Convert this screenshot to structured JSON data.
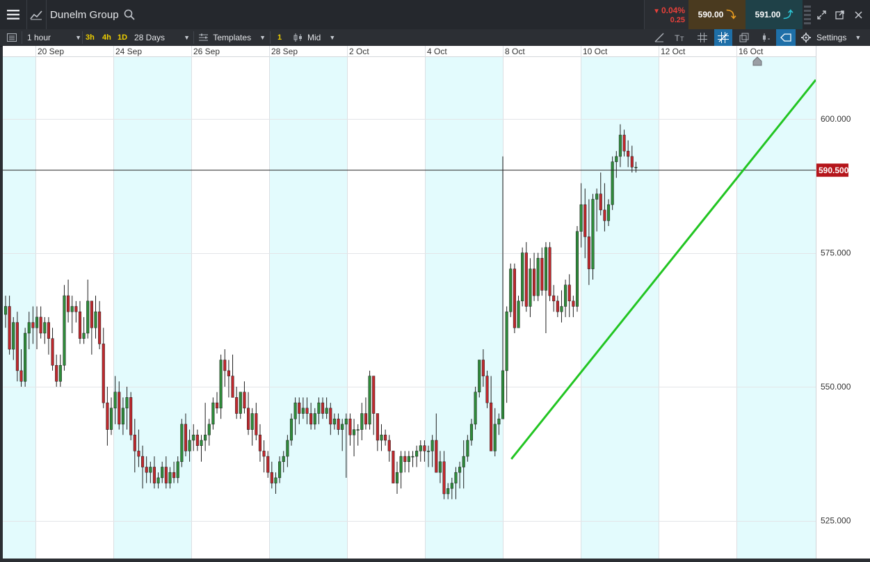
{
  "header": {
    "title": "Dunelm Group",
    "change_pct": "0.04%",
    "change_abs": "0.25",
    "sell_price": "590.00",
    "buy_price": "591.00",
    "icons": [
      "menu-icon",
      "chart-type-icon",
      "search-icon",
      "expand-icon",
      "popout-icon",
      "close-icon"
    ]
  },
  "toolbar": {
    "interval": "1 hour",
    "quick_intervals": [
      "3h",
      "4h",
      "1D"
    ],
    "range": "28 Days",
    "templates_label": "Templates",
    "badge": "1",
    "price_type": "Mid",
    "settings_label": "Settings"
  },
  "chart_data": {
    "type": "candlestick",
    "x_ticks": [
      "20 Sep",
      "24 Sep",
      "26 Sep",
      "28 Sep",
      "2 Oct",
      "4 Oct",
      "8 Oct",
      "10 Oct",
      "12 Oct",
      "16 Oct"
    ],
    "y_ticks": [
      "600.000",
      "575.000",
      "550.000",
      "525.000"
    ],
    "ylim": [
      520.0,
      608.0
    ],
    "current_price": "590.500",
    "colors": {
      "up": "#2e8b3a",
      "down": "#c0282d",
      "trend": "#22c522",
      "price_tag": "#b5151b",
      "weekend": "#e3fbfd"
    },
    "candles": [
      [
        563.5,
        567,
        561,
        565
      ],
      [
        565,
        567,
        556,
        557
      ],
      [
        557,
        563,
        555,
        562
      ],
      [
        562,
        564,
        551,
        553
      ],
      [
        553,
        557,
        550,
        551
      ],
      [
        551,
        561,
        550,
        560
      ],
      [
        560,
        564,
        557,
        562
      ],
      [
        562,
        565,
        558,
        561
      ],
      [
        561,
        565,
        557,
        563
      ],
      [
        563,
        565,
        559,
        560
      ],
      [
        560,
        563,
        558,
        562
      ],
      [
        562,
        563,
        556,
        559
      ],
      [
        559,
        561,
        553,
        554
      ],
      [
        554,
        556,
        550,
        551
      ],
      [
        551,
        556,
        550,
        554
      ],
      [
        554,
        569,
        553,
        567
      ],
      [
        567,
        570,
        562,
        564
      ],
      [
        564,
        567,
        560,
        565
      ],
      [
        565,
        566,
        562,
        564
      ],
      [
        564,
        566,
        558,
        559
      ],
      [
        559,
        563,
        558,
        560
      ],
      [
        560,
        570,
        559,
        566
      ],
      [
        566,
        566,
        556,
        561
      ],
      [
        561,
        567,
        559,
        564
      ],
      [
        564,
        566,
        557,
        558
      ],
      [
        558,
        561,
        546,
        547
      ],
      [
        547,
        550,
        539,
        542
      ],
      [
        542,
        548,
        541,
        546
      ],
      [
        546,
        552,
        543,
        549
      ],
      [
        549,
        551,
        542,
        543
      ],
      [
        543,
        548,
        541,
        546
      ],
      [
        546,
        550,
        542,
        548
      ],
      [
        548,
        549,
        540,
        541
      ],
      [
        541,
        544,
        534,
        538
      ],
      [
        538,
        542,
        535,
        537
      ],
      [
        537,
        539,
        531,
        535
      ],
      [
        535,
        537,
        532,
        534
      ],
      [
        534,
        536,
        532,
        535
      ],
      [
        535,
        537,
        531,
        532
      ],
      [
        532,
        534,
        531,
        533
      ],
      [
        533,
        536,
        532,
        535
      ],
      [
        535,
        537,
        531,
        532
      ],
      [
        532,
        535,
        531,
        534
      ],
      [
        534,
        536,
        532,
        533
      ],
      [
        533,
        537,
        532,
        536
      ],
      [
        536,
        544,
        535,
        543
      ],
      [
        543,
        545,
        537,
        538
      ],
      [
        538,
        542,
        536,
        540
      ],
      [
        540,
        543,
        538,
        541
      ],
      [
        541,
        542,
        538,
        539
      ],
      [
        539,
        541,
        536,
        540
      ],
      [
        540,
        547,
        538,
        541
      ],
      [
        541,
        544,
        539,
        543
      ],
      [
        543,
        548,
        542,
        547
      ],
      [
        547,
        549,
        545,
        546
      ],
      [
        546,
        556,
        544,
        555
      ],
      [
        555,
        557,
        550,
        553
      ],
      [
        553,
        555,
        548,
        552
      ],
      [
        552,
        556,
        548,
        548
      ],
      [
        548,
        550,
        544,
        545
      ],
      [
        545,
        549,
        544,
        549
      ],
      [
        549,
        551,
        545,
        546
      ],
      [
        546,
        549,
        541,
        542
      ],
      [
        542,
        546,
        539,
        545
      ],
      [
        545,
        547,
        540,
        541
      ],
      [
        541,
        543,
        536,
        538
      ],
      [
        538,
        540,
        534,
        537
      ],
      [
        537,
        538,
        533,
        534
      ],
      [
        534,
        536,
        531,
        532
      ],
      [
        532,
        534,
        530,
        533
      ],
      [
        533,
        537,
        532,
        536
      ],
      [
        536,
        538,
        534,
        537
      ],
      [
        537,
        541,
        535,
        540
      ],
      [
        540,
        545,
        539,
        544
      ],
      [
        544,
        548,
        541,
        547
      ],
      [
        547,
        548,
        543,
        545
      ],
      [
        545,
        548,
        544,
        546
      ],
      [
        546,
        548,
        543,
        545
      ],
      [
        545,
        547,
        542,
        543
      ],
      [
        543,
        546,
        542,
        545
      ],
      [
        545,
        548,
        543,
        547
      ],
      [
        547,
        548,
        544,
        545
      ],
      [
        545,
        548,
        544,
        546
      ],
      [
        546,
        547,
        541,
        543
      ],
      [
        543,
        545,
        542,
        544
      ],
      [
        544,
        545,
        541,
        542
      ],
      [
        542,
        544,
        538,
        543
      ],
      [
        543,
        545,
        533,
        544
      ],
      [
        544,
        545,
        539,
        541
      ],
      [
        541,
        544,
        537,
        542
      ],
      [
        542,
        543,
        539,
        542
      ],
      [
        542,
        547,
        540,
        545
      ],
      [
        545,
        548,
        542,
        543
      ],
      [
        543,
        553,
        542,
        552
      ],
      [
        552,
        552,
        541,
        545
      ],
      [
        545,
        545,
        538,
        540
      ],
      [
        540,
        543,
        538,
        541
      ],
      [
        541,
        542,
        539,
        540
      ],
      [
        540,
        541,
        536,
        538
      ],
      [
        538,
        538,
        532,
        532
      ],
      [
        532,
        536,
        530,
        534
      ],
      [
        534,
        538,
        531,
        537
      ],
      [
        537,
        538,
        534,
        536
      ],
      [
        536,
        538,
        534,
        537
      ],
      [
        537,
        538,
        535,
        537
      ],
      [
        537,
        539,
        535,
        538
      ],
      [
        538,
        540,
        536,
        539
      ],
      [
        539,
        540,
        536,
        538
      ],
      [
        538,
        539,
        535,
        538
      ],
      [
        538,
        541,
        535,
        540
      ],
      [
        540,
        545,
        534,
        534
      ],
      [
        534,
        538,
        532,
        536
      ],
      [
        536,
        538,
        529,
        530
      ],
      [
        530,
        532,
        529,
        531
      ],
      [
        531,
        533,
        529,
        532
      ],
      [
        532,
        535,
        529,
        534
      ],
      [
        534,
        536,
        531,
        535
      ],
      [
        535,
        540,
        531,
        537
      ],
      [
        537,
        541,
        536,
        540
      ],
      [
        540,
        544,
        539,
        543
      ],
      [
        543,
        550,
        542,
        549
      ],
      [
        549,
        554,
        548,
        555
      ],
      [
        555,
        557,
        550,
        552
      ],
      [
        552,
        553,
        546,
        547
      ],
      [
        547,
        552,
        538,
        538
      ],
      [
        538,
        546,
        537,
        543
      ],
      [
        543,
        545,
        541,
        544
      ],
      [
        544,
        593,
        546,
        553
      ],
      [
        553,
        565,
        547,
        564
      ],
      [
        564,
        573,
        563,
        572
      ],
      [
        572,
        573,
        560,
        561
      ],
      [
        561,
        567,
        561,
        566
      ],
      [
        566,
        576,
        565,
        575
      ],
      [
        575,
        577,
        564,
        565
      ],
      [
        565,
        574,
        563,
        572
      ],
      [
        572,
        575,
        566,
        567
      ],
      [
        567,
        575,
        566,
        574
      ],
      [
        574,
        576,
        567,
        568
      ],
      [
        568,
        577,
        560,
        576
      ],
      [
        576,
        577,
        566,
        567
      ],
      [
        567,
        569,
        564,
        566
      ],
      [
        566,
        567,
        563,
        564
      ],
      [
        564,
        568,
        562,
        565
      ],
      [
        565,
        570,
        563,
        569
      ],
      [
        569,
        571,
        563,
        566
      ],
      [
        566,
        567,
        563,
        565
      ],
      [
        565,
        580,
        564,
        579
      ],
      [
        579,
        588,
        576,
        584
      ],
      [
        584,
        587,
        574,
        578
      ],
      [
        578,
        585,
        569,
        572
      ],
      [
        572,
        586,
        570,
        585
      ],
      [
        585,
        587,
        579,
        586
      ],
      [
        586,
        590,
        582,
        583
      ],
      [
        583,
        588,
        579,
        581
      ],
      [
        581,
        585,
        580,
        584
      ],
      [
        584,
        593,
        583,
        592
      ],
      [
        592,
        594,
        589,
        593
      ],
      [
        593,
        599,
        591,
        597
      ],
      [
        597,
        598,
        593,
        594
      ],
      [
        594,
        596,
        591,
        593
      ],
      [
        593,
        595,
        590,
        591
      ],
      [
        591,
        592,
        590,
        591
      ]
    ]
  }
}
